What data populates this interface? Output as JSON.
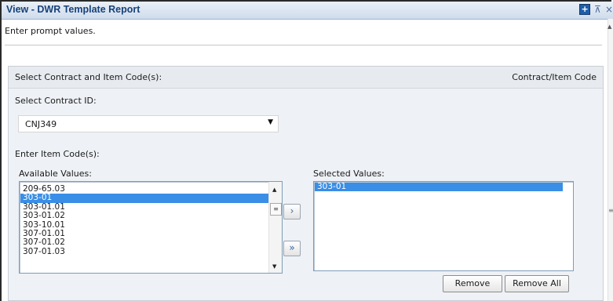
{
  "window": {
    "title": "View - DWR Template Report"
  },
  "prompt": {
    "instruction": "Enter prompt values."
  },
  "section": {
    "title": "Select Contract and Item Code(s):",
    "tag": "Contract/Item Code"
  },
  "contract": {
    "label": "Select Contract ID:",
    "selected": "CNJ349"
  },
  "item_codes": {
    "label": "Enter Item Code(s):",
    "available_label": "Available Values:",
    "available": [
      "209-65.03",
      "303-01",
      "303-01.01",
      "303-01.02",
      "303-10.01",
      "307-01.01",
      "307-01.02",
      "307-01.03"
    ],
    "available_selected_index": 1,
    "selected_label": "Selected Values:",
    "selected": [
      "303-01"
    ]
  },
  "buttons": {
    "add": "›",
    "add_all": "»",
    "remove": "Remove",
    "remove_all": "Remove All"
  },
  "icons": [
    "maximize-icon",
    "pin-icon",
    "close-icon"
  ]
}
